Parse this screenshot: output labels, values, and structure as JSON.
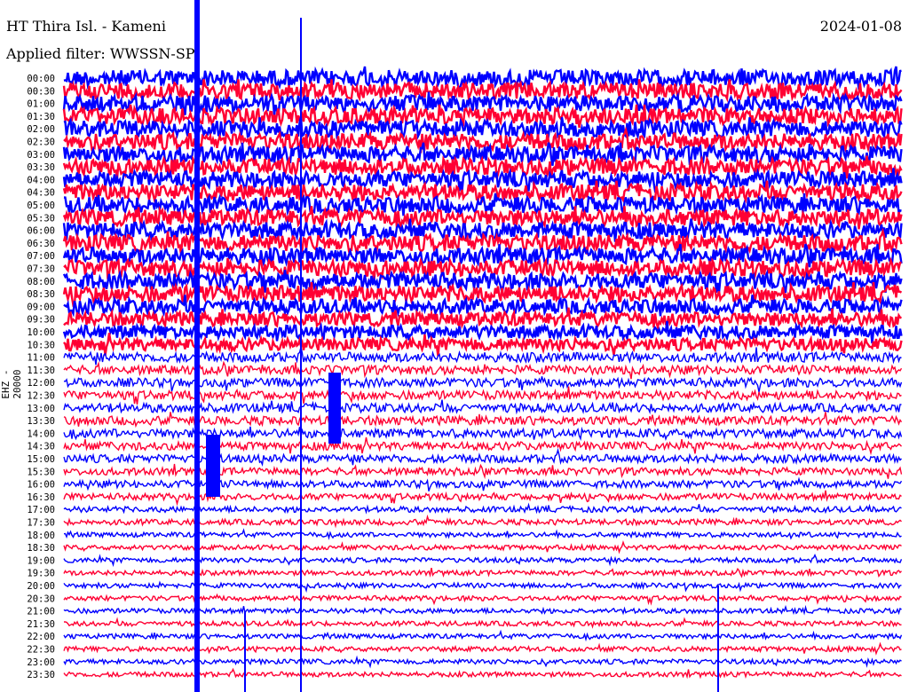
{
  "chart_data": {
    "type": "line",
    "title": "HT Thira Isl. - Kameni",
    "filter": "Applied filter: WWSSN-SP",
    "date": "2024-01-08",
    "ylabel": "EHZ - 20000",
    "tick_labels": [
      "00:00",
      "00:30",
      "01:00",
      "01:30",
      "02:00",
      "02:30",
      "03:00",
      "03:30",
      "04:00",
      "04:30",
      "05:00",
      "05:30",
      "06:00",
      "06:30",
      "07:00",
      "07:30",
      "08:00",
      "08:30",
      "09:00",
      "09:30",
      "10:00",
      "10:30",
      "11:00",
      "11:30",
      "12:00",
      "12:30",
      "13:00",
      "13:30",
      "14:00",
      "14:30",
      "15:00",
      "15:30",
      "16:00",
      "16:30",
      "17:00",
      "17:30",
      "18:00",
      "18:30",
      "19:00",
      "19:30",
      "20:00",
      "20:30",
      "21:00",
      "21:30",
      "22:00",
      "22:30",
      "23:00",
      "23:30"
    ],
    "series_colors": [
      "#0000ff",
      "#ff0033"
    ],
    "relative_noise_level": [
      1,
      1,
      1,
      1,
      1,
      1,
      1,
      1,
      1,
      1,
      1,
      1,
      1,
      1,
      1,
      1,
      1,
      1,
      0.9,
      0.85,
      0.8,
      0.75,
      0.6,
      0.55,
      0.55,
      0.55,
      0.55,
      0.55,
      0.55,
      0.5,
      0.5,
      0.45,
      0.45,
      0.4,
      0.35,
      0.35,
      0.3,
      0.3,
      0.3,
      0.3,
      0.3,
      0.3,
      0.3,
      0.3,
      0.3,
      0.3,
      0.3,
      0.3
    ]
  }
}
